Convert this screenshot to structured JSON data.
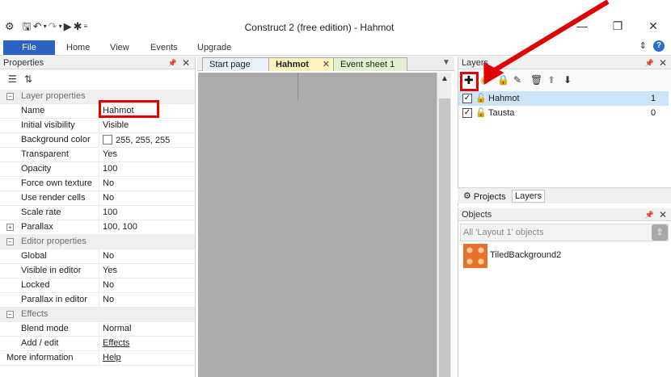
{
  "window": {
    "title": "Construct 2  (free edition) - Hahmot",
    "minimize": "—",
    "restore": "❐",
    "close": "✕"
  },
  "quick_access": {
    "app_icon": "gear-icon",
    "save": "save-icon",
    "undo": "undo-icon",
    "redo": "redo-icon",
    "run": "run-icon",
    "debug": "bug-icon"
  },
  "ribbon": {
    "file": "File",
    "tabs": [
      "Home",
      "View",
      "Events",
      "Upgrade"
    ]
  },
  "properties": {
    "title": "Properties",
    "rows": [
      {
        "type": "category",
        "label": "Layer properties"
      },
      {
        "type": "prop",
        "label": "Name",
        "value": "Hahmot"
      },
      {
        "type": "prop",
        "label": "Initial visibility",
        "value": "Visible"
      },
      {
        "type": "prop",
        "label": "Background color",
        "value": "255, 255, 255"
      },
      {
        "type": "prop",
        "label": "Transparent",
        "value": "Yes"
      },
      {
        "type": "prop",
        "label": "Opacity",
        "value": "100"
      },
      {
        "type": "prop",
        "label": "Force own texture",
        "value": "No"
      },
      {
        "type": "prop",
        "label": "Use render cells",
        "value": "No"
      },
      {
        "type": "prop",
        "label": "Scale rate",
        "value": "100"
      },
      {
        "type": "expandable",
        "label": "Parallax",
        "value": "100, 100"
      },
      {
        "type": "category",
        "label": "Editor properties"
      },
      {
        "type": "prop",
        "label": "Global",
        "value": "No"
      },
      {
        "type": "prop",
        "label": "Visible in editor",
        "value": "Yes"
      },
      {
        "type": "prop",
        "label": "Locked",
        "value": "No"
      },
      {
        "type": "prop",
        "label": "Parallax in editor",
        "value": "No"
      },
      {
        "type": "category",
        "label": "Effects"
      },
      {
        "type": "prop",
        "label": "Blend mode",
        "value": "Normal"
      },
      {
        "type": "prop",
        "label": "Add / edit",
        "value": "Effects",
        "link": true
      },
      {
        "type": "info",
        "label": "More information",
        "value": "Help",
        "link": true
      }
    ]
  },
  "doc_tabs": {
    "start": "Start page",
    "hahmot": "Hahmot",
    "event": "Event sheet 1",
    "close": "✕"
  },
  "layers": {
    "title": "Layers",
    "items": [
      {
        "name": "Hahmot",
        "index": "1",
        "checked": true,
        "selected": true
      },
      {
        "name": "Tausta",
        "index": "0",
        "checked": true,
        "selected": false
      }
    ],
    "tabs": {
      "projects": "Projects",
      "layers": "Layers"
    }
  },
  "objects": {
    "title": "Objects",
    "filter": "All 'Layout 1' objects",
    "items": [
      {
        "name": "TiledBackground2"
      }
    ]
  },
  "colors": {
    "accent_red": "#e00000",
    "file_tab": "#2b63c1",
    "selected_row": "#cce4f7",
    "canvas": "#ababab"
  }
}
